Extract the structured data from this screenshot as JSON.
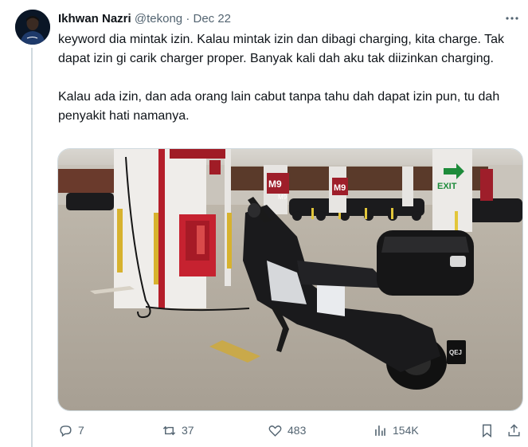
{
  "tweet": {
    "display_name": "Ikhwan Nazri",
    "handle": "@tekong",
    "separator": "·",
    "date": "Dec 22",
    "more_icon": "more-dots-icon",
    "paragraphs": [
      "keyword dia mintak izin. Kalau mintak izin dan dibagi charging, kita charge. Tak dapat izin gi carik charger proper. Banyak kali dah aku tak diizinkan charging.",
      "Kalau ada izin, dan ada orang lain cabut tanpa tahu dah dapat izin pun, tu dah penyakit hati namanya."
    ],
    "media": {
      "signs": [
        "M9",
        "M9",
        "M9"
      ],
      "exit_sign": "EXIT",
      "plate": "QEJ"
    },
    "actions": {
      "replies": "7",
      "reposts": "37",
      "likes": "483",
      "views": "154K"
    }
  },
  "colors": {
    "text": "#0f1419",
    "secondary": "#536471",
    "border": "#cfd9de",
    "exit_green": "#1d8b3a"
  }
}
